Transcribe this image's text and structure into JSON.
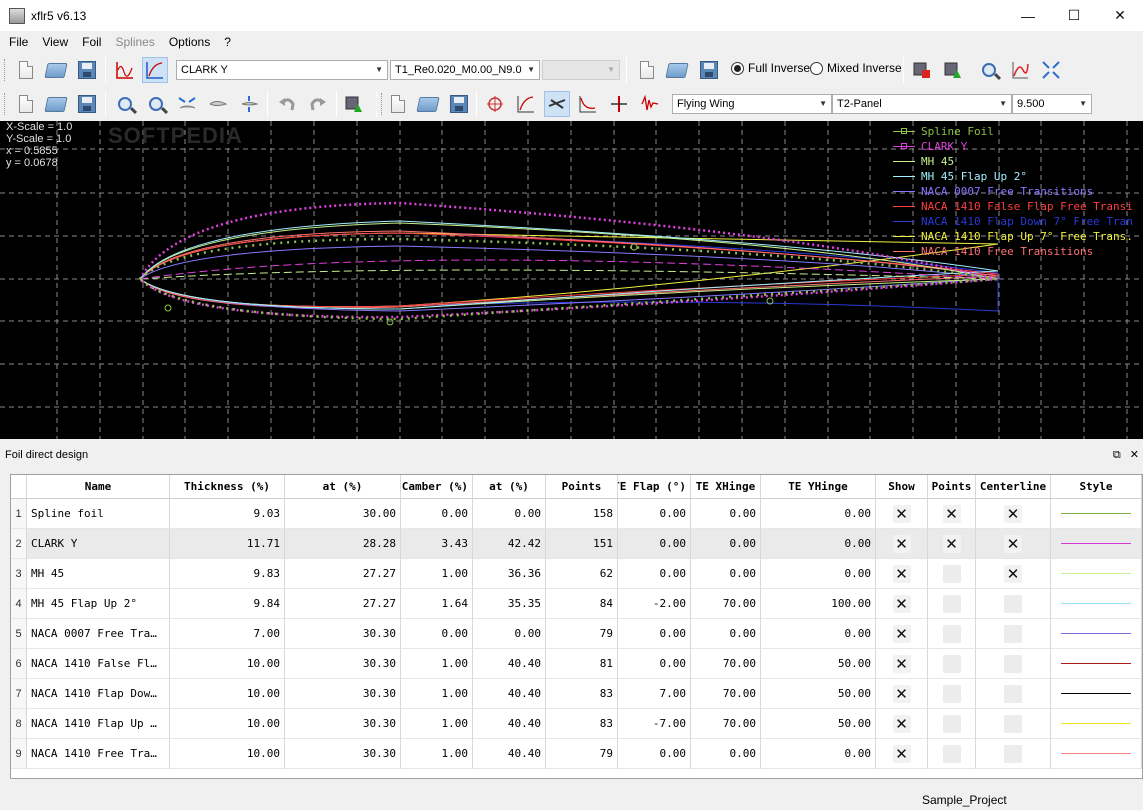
{
  "window": {
    "title": "xflr5 v6.13",
    "minimize_glyph": "—",
    "maximize_glyph": "☐",
    "close_glyph": "✕"
  },
  "menu": [
    "File",
    "View",
    "Foil",
    "Splines",
    "Options",
    "?"
  ],
  "toolbar1": {
    "foil_combo": "CLARK Y",
    "polar_combo": "T1_Re0.020_M0.00_N9.0",
    "opp_combo": "",
    "radio_full_inverse": "Full Inverse",
    "radio_mixed_inverse": "Mixed Inverse",
    "full_inverse_selected": true
  },
  "toolbar2": {
    "plane_combo": "Flying Wing",
    "wpolar_combo": "T2-Panel",
    "opp_combo": "9.500"
  },
  "graph": {
    "scale_lines": [
      "X-Scale = 1.0",
      "Y-Scale = 1.0",
      "x  = 0.5855",
      "y  = 0.0678"
    ],
    "watermark": "SOFTPEDIA",
    "legend": [
      {
        "name": "Spline Foil",
        "color": "#8bc34a",
        "marker": true
      },
      {
        "name": "CLARK Y",
        "color": "#e040e0",
        "marker": true
      },
      {
        "name": "MH 45",
        "color": "#c8f08c",
        "marker": false
      },
      {
        "name": "MH 45 Flap Up 2°",
        "color": "#a0f0ff",
        "marker": false
      },
      {
        "name": "NACA 0007 Free Transitions",
        "color": "#8878ff",
        "marker": false
      },
      {
        "name": "NACA 1410 False Flap Free Transi",
        "color": "#ff4040",
        "marker": false
      },
      {
        "name": "NACA 1410 Flap Down 7° Free Tran",
        "color": "#2838d8",
        "marker": false
      },
      {
        "name": "NACA 1410 Flap Up 7° Free Trans.",
        "color": "#f0f040",
        "marker": false
      },
      {
        "name": "NACA 1410 Free Transitions",
        "color": "#ff7070",
        "marker": false
      }
    ]
  },
  "dock": {
    "title": "Foil direct design",
    "float_glyph": "⧉",
    "close_glyph": "✕"
  },
  "table": {
    "headers": [
      "Name",
      "Thickness (%)",
      "at (%)",
      "Camber (%)",
      "at (%)",
      "Points",
      "TE Flap (°)",
      "TE XHinge",
      "TE YHinge",
      "Show",
      "Points",
      "Centerline",
      "Style"
    ],
    "rows": [
      {
        "no": "1",
        "name": "Spline foil",
        "thick": "9.03",
        "thick_at": "30.00",
        "camber": "0.00",
        "camber_at": "0.00",
        "points": "158",
        "flap": "0.00",
        "xhinge": "0.00",
        "yhinge": "0.00",
        "show": true,
        "pts": true,
        "center": true,
        "color": "#7cb342"
      },
      {
        "no": "2",
        "name": "CLARK Y",
        "thick": "11.71",
        "thick_at": "28.28",
        "camber": "3.43",
        "camber_at": "42.42",
        "points": "151",
        "flap": "0.00",
        "xhinge": "0.00",
        "yhinge": "0.00",
        "show": true,
        "pts": true,
        "center": true,
        "color": "#d63ad6"
      },
      {
        "no": "3",
        "name": "MH 45",
        "thick": "9.83",
        "thick_at": "27.27",
        "camber": "1.00",
        "camber_at": "36.36",
        "points": "62",
        "flap": "0.00",
        "xhinge": "0.00",
        "yhinge": "0.00",
        "show": true,
        "pts": false,
        "center": true,
        "color": "#c8f08c"
      },
      {
        "no": "4",
        "name": "MH 45 Flap Up 2°",
        "thick": "9.84",
        "thick_at": "27.27",
        "camber": "1.64",
        "camber_at": "35.35",
        "points": "84",
        "flap": "-2.00",
        "xhinge": "70.00",
        "yhinge": "100.00",
        "show": true,
        "pts": false,
        "center": false,
        "color": "#8fe3f5"
      },
      {
        "no": "5",
        "name": "NACA 0007 Free Tra…",
        "thick": "7.00",
        "thick_at": "30.30",
        "camber": "0.00",
        "camber_at": "0.00",
        "points": "79",
        "flap": "0.00",
        "xhinge": "0.00",
        "yhinge": "0.00",
        "show": true,
        "pts": false,
        "center": false,
        "color": "#7a6fd8"
      },
      {
        "no": "6",
        "name": "NACA 1410 False Fl…",
        "thick": "10.00",
        "thick_at": "30.30",
        "camber": "1.00",
        "camber_at": "40.40",
        "points": "81",
        "flap": "0.00",
        "xhinge": "70.00",
        "yhinge": "50.00",
        "show": true,
        "pts": false,
        "center": false,
        "color": "#a81c1c"
      },
      {
        "no": "7",
        "name": "NACA 1410 Flap Dow…",
        "thick": "10.00",
        "thick_at": "30.30",
        "camber": "1.00",
        "camber_at": "40.40",
        "points": "83",
        "flap": "7.00",
        "xhinge": "70.00",
        "yhinge": "50.00",
        "show": true,
        "pts": false,
        "center": false,
        "color": "#000000"
      },
      {
        "no": "8",
        "name": "NACA 1410 Flap Up …",
        "thick": "10.00",
        "thick_at": "30.30",
        "camber": "1.00",
        "camber_at": "40.40",
        "points": "83",
        "flap": "-7.00",
        "xhinge": "70.00",
        "yhinge": "50.00",
        "show": true,
        "pts": false,
        "center": false,
        "color": "#f0e020"
      },
      {
        "no": "9",
        "name": "NACA 1410 Free Tra…",
        "thick": "10.00",
        "thick_at": "30.30",
        "camber": "1.00",
        "camber_at": "40.40",
        "points": "79",
        "flap": "0.00",
        "xhinge": "0.00",
        "yhinge": "0.00",
        "show": true,
        "pts": false,
        "center": false,
        "color": "#f08080"
      }
    ],
    "check_glyph": "✕"
  },
  "status": {
    "project": "Sample_Project"
  }
}
